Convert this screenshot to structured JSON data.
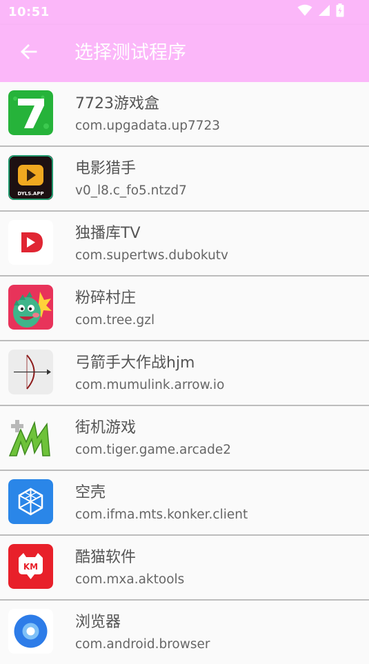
{
  "status_bar": {
    "time": "10:51"
  },
  "app_bar": {
    "title": "选择测试程序",
    "back_icon": "arrow-back-icon"
  },
  "apps": [
    {
      "name": "7723游戏盒",
      "package": "com.upgadata.up7723",
      "icon": "7723-app-icon"
    },
    {
      "name": "电影猎手",
      "package": "v0_l8.c_fo5.ntzd7",
      "icon": "movie-hunter-app-icon",
      "icon_text": "DYLS.APP"
    },
    {
      "name": "独播库TV",
      "package": "com.supertws.dubokutv",
      "icon": "duboku-app-icon"
    },
    {
      "name": "粉碎村庄",
      "package": "com.tree.gzl",
      "icon": "smash-village-app-icon"
    },
    {
      "name": "弓箭手大作战hjm",
      "package": "com.mumulink.arrow.io",
      "icon": "archer-app-icon"
    },
    {
      "name": "街机游戏",
      "package": "com.tiger.game.arcade2",
      "icon": "arcade-app-icon"
    },
    {
      "name": "空壳",
      "package": "com.ifma.mts.konker.client",
      "icon": "konker-app-icon"
    },
    {
      "name": "酷猫软件",
      "package": "com.mxa.aktools",
      "icon": "kumao-app-icon",
      "icon_text": "KM"
    },
    {
      "name": "浏览器",
      "package": "com.android.browser",
      "icon": "browser-app-icon"
    }
  ],
  "colors": {
    "accent": "#fbb7f9",
    "divider": "#bcbcbc",
    "background": "#fafafa"
  }
}
